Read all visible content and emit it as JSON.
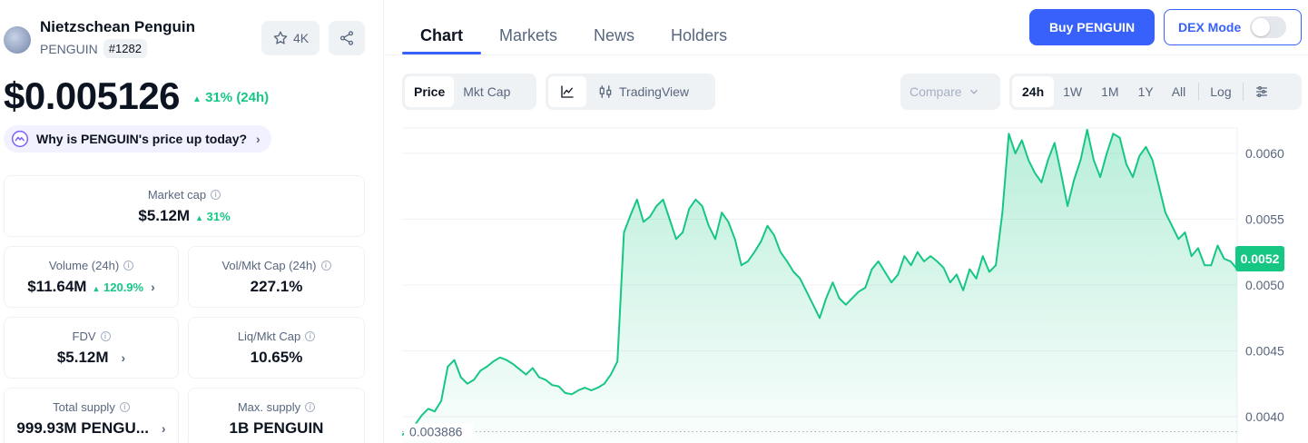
{
  "coin": {
    "name": "Nietzschean Penguin",
    "symbol": "PENGUIN",
    "rank": "#1282",
    "watchlist_count": "4K",
    "price": "$0.005126",
    "change_24h": "31% (24h)",
    "why_prompt": "Why is PENGUIN's price up today?"
  },
  "stats": {
    "market_cap": {
      "label": "Market cap",
      "value": "$5.12M",
      "change": "31%"
    },
    "volume": {
      "label": "Volume (24h)",
      "value": "$11.64M",
      "change": "120.9%"
    },
    "vol_mkt_cap": {
      "label": "Vol/Mkt Cap (24h)",
      "value": "227.1%"
    },
    "fdv": {
      "label": "FDV",
      "value": "$5.12M"
    },
    "liq_mkt_cap": {
      "label": "Liq/Mkt Cap",
      "value": "10.65%"
    },
    "total_supply": {
      "label": "Total supply",
      "value": "999.93M PENGU..."
    },
    "max_supply": {
      "label": "Max. supply",
      "value": "1B PENGUIN"
    }
  },
  "tabs": [
    "Chart",
    "Markets",
    "News",
    "Holders"
  ],
  "actions": {
    "buy": "Buy PENGUIN",
    "dex_mode": "DEX Mode",
    "dex_mode_on": false
  },
  "toolbar": {
    "price": "Price",
    "mkt_cap": "Mkt Cap",
    "tradingview": "TradingView",
    "compare": "Compare",
    "ranges": [
      "24h",
      "1W",
      "1M",
      "1Y",
      "All"
    ],
    "active_range": "24h",
    "log": "Log"
  },
  "colors": {
    "accent": "#3861fb",
    "up": "#16c784",
    "muted": "#58667e"
  },
  "icons": [
    "star-icon",
    "share-icon",
    "sparkle-icon",
    "line-chart-icon",
    "candles-icon",
    "chevron-down-icon",
    "settings-sliders-icon",
    "info-icon",
    "chevron-right-icon",
    "up-triangle-icon"
  ],
  "chart_data": {
    "type": "area",
    "ylim": [
      0.0038,
      0.0062
    ],
    "yticks": [
      "0.0060",
      "0.0055",
      "0.0050",
      "0.0045",
      "0.0040"
    ],
    "ytick_values": [
      0.006,
      0.0055,
      0.005,
      0.0045,
      0.004
    ],
    "open_price_label": "0.003886",
    "open_price": 0.003886,
    "current_label": "0.0052",
    "current_price": 0.0052,
    "series": [
      {
        "values": [
          0.00386,
          0.0039,
          0.00394,
          0.00401,
          0.00406,
          0.00404,
          0.00412,
          0.00438,
          0.00443,
          0.0043,
          0.00425,
          0.00428,
          0.00435,
          0.00438,
          0.00442,
          0.00445,
          0.00443,
          0.0044,
          0.00436,
          0.00432,
          0.00437,
          0.0043,
          0.00428,
          0.00424,
          0.00423,
          0.00418,
          0.00417,
          0.0042,
          0.00422,
          0.0042,
          0.00422,
          0.00425,
          0.00432,
          0.00442,
          0.0054,
          0.00553,
          0.00565,
          0.00548,
          0.00552,
          0.0056,
          0.00565,
          0.0055,
          0.00535,
          0.0054,
          0.00558,
          0.00565,
          0.0056,
          0.00545,
          0.00535,
          0.00555,
          0.00548,
          0.00535,
          0.00515,
          0.00518,
          0.00525,
          0.00533,
          0.00545,
          0.00538,
          0.00525,
          0.00518,
          0.0051,
          0.00505,
          0.00495,
          0.00485,
          0.00475,
          0.0049,
          0.00502,
          0.0049,
          0.00485,
          0.0049,
          0.00495,
          0.00498,
          0.00512,
          0.00518,
          0.0051,
          0.00502,
          0.00508,
          0.00522,
          0.00515,
          0.00525,
          0.00518,
          0.00522,
          0.00518,
          0.00513,
          0.00502,
          0.00508,
          0.00496,
          0.00512,
          0.00505,
          0.00522,
          0.0051,
          0.00515,
          0.00555,
          0.00615,
          0.006,
          0.0061,
          0.00595,
          0.00585,
          0.00578,
          0.00595,
          0.00608,
          0.00585,
          0.0056,
          0.0058,
          0.00595,
          0.00618,
          0.00595,
          0.00582,
          0.006,
          0.00615,
          0.00612,
          0.00592,
          0.00582,
          0.00598,
          0.00605,
          0.00595,
          0.00575,
          0.00555,
          0.00545,
          0.00535,
          0.0054,
          0.00522,
          0.00528,
          0.00515,
          0.00515,
          0.0053,
          0.0052,
          0.00518,
          0.00512
        ]
      }
    ]
  }
}
